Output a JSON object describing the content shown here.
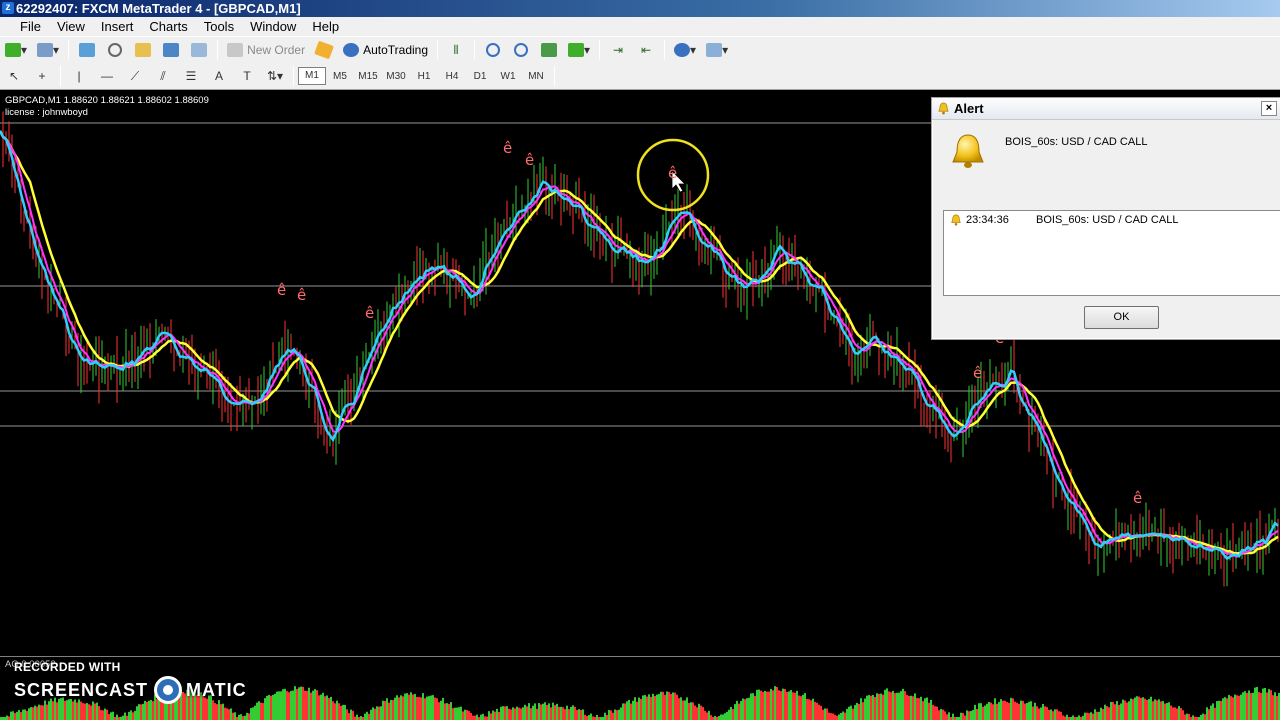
{
  "window": {
    "title": "62292407: FXCM MetaTrader 4 - [GBPCAD,M1]",
    "app_icon": "mt4-icon"
  },
  "menu": [
    "File",
    "View",
    "Insert",
    "Charts",
    "Tools",
    "Window",
    "Help"
  ],
  "toolbar1": {
    "new_order": "New Order",
    "auto_trading": "AutoTrading"
  },
  "toolbar2": {
    "timeframes": [
      "M1",
      "M5",
      "M15",
      "M30",
      "H1",
      "H4",
      "D1",
      "W1",
      "MN"
    ],
    "active_timeframe": "M1",
    "text_tool": "A"
  },
  "chart": {
    "symbol_line": "GBPCAD,M1  1.88620 1.88621 1.88602 1.88609",
    "license_line": "license : johnwboyd",
    "arrow_glyph": "ê",
    "background": "#000000",
    "ma_colors": {
      "fast": "#33ccff",
      "mid": "#ff33ff",
      "slow": "#ffff33"
    },
    "candle_colors": {
      "up": "#33cc33",
      "down": "#ff3333"
    }
  },
  "oscillator": {
    "label": "AO 0.00052"
  },
  "watermark": {
    "line1": "RECORDED WITH",
    "line2a": "SCREENCAST",
    "line2b": "MATIC"
  },
  "alert": {
    "title": "Alert",
    "message": "BOIS_60s: USD / CAD  CALL",
    "history": [
      {
        "time": "23:34:36",
        "text": "BOIS_60s: USD / CAD  CALL"
      }
    ],
    "ok_label": "OK",
    "close_glyph": "×"
  }
}
